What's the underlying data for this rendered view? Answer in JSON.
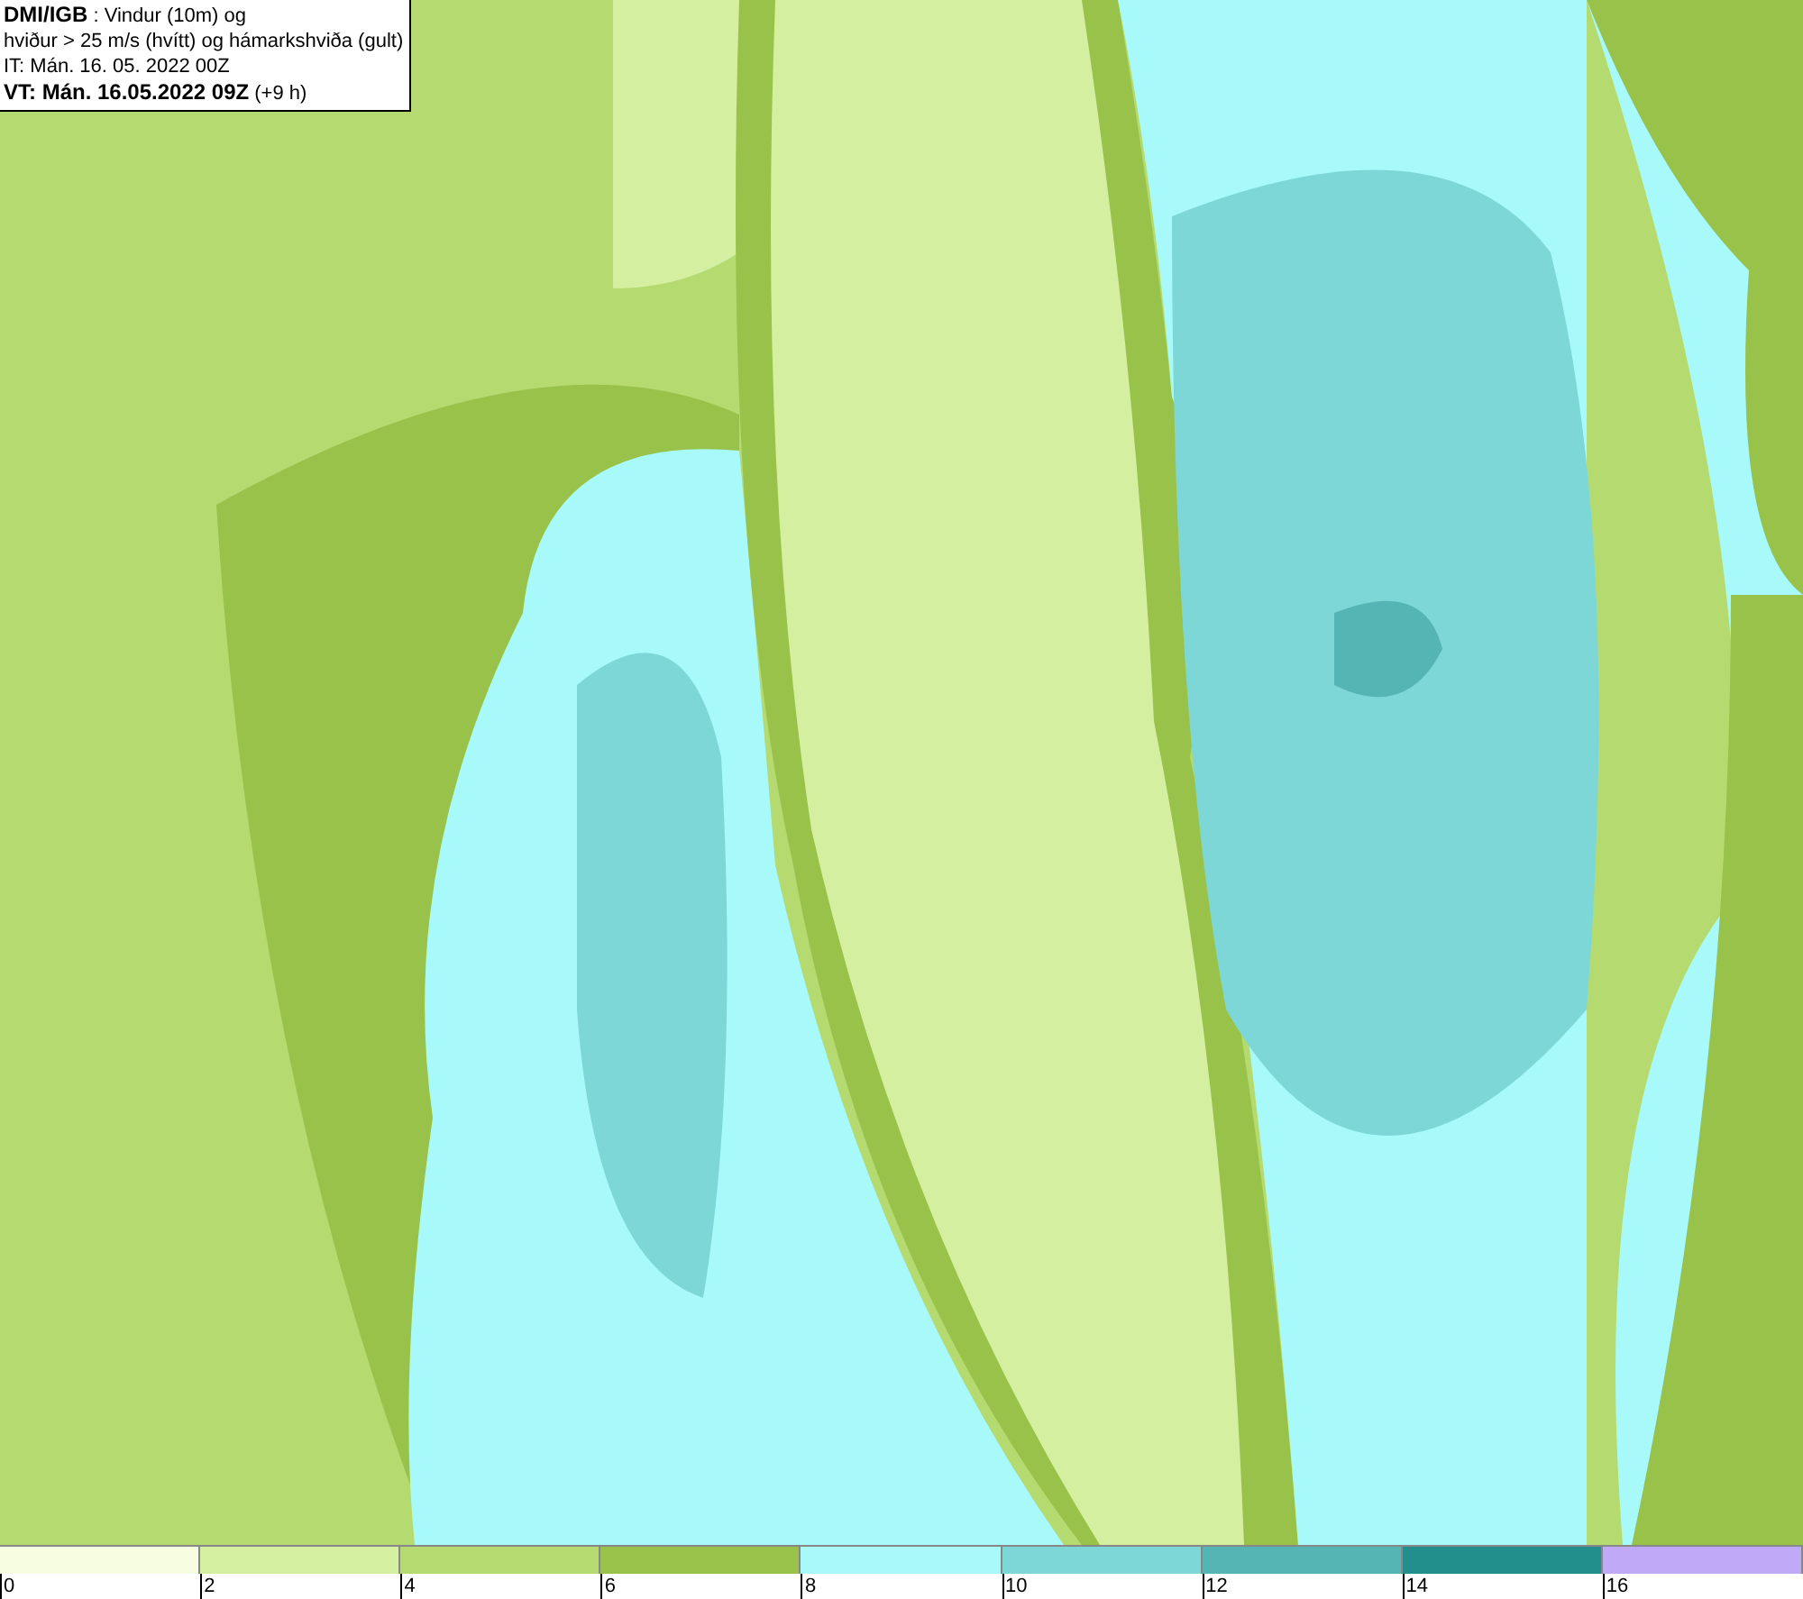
{
  "header": {
    "lines": [
      "**DMI/IGB** : Vindur (10m) og",
      "hviður > 25 m/s (hvítt) og hámarkshviða (gult)",
      "IT: Mán. 16. 05. 2022 00Z",
      "**VT: Mán. 16.05.2022 09Z** (+9 h)"
    ]
  },
  "legend": {
    "bins": [
      {
        "label": "0",
        "color": "#f6fde0"
      },
      {
        "label": "2",
        "color": "#d4efa0"
      },
      {
        "label": "4",
        "color": "#b4da70"
      },
      {
        "label": "6",
        "color": "#98c24a"
      },
      {
        "label": "8",
        "color": "#a8fafa"
      },
      {
        "label": "10",
        "color": "#7ed7d7"
      },
      {
        "label": "12",
        "color": "#55b4b4"
      },
      {
        "label": "14",
        "color": "#238f8c"
      },
      {
        "label": "16",
        "color": "#c0aaf8"
      }
    ]
  }
}
